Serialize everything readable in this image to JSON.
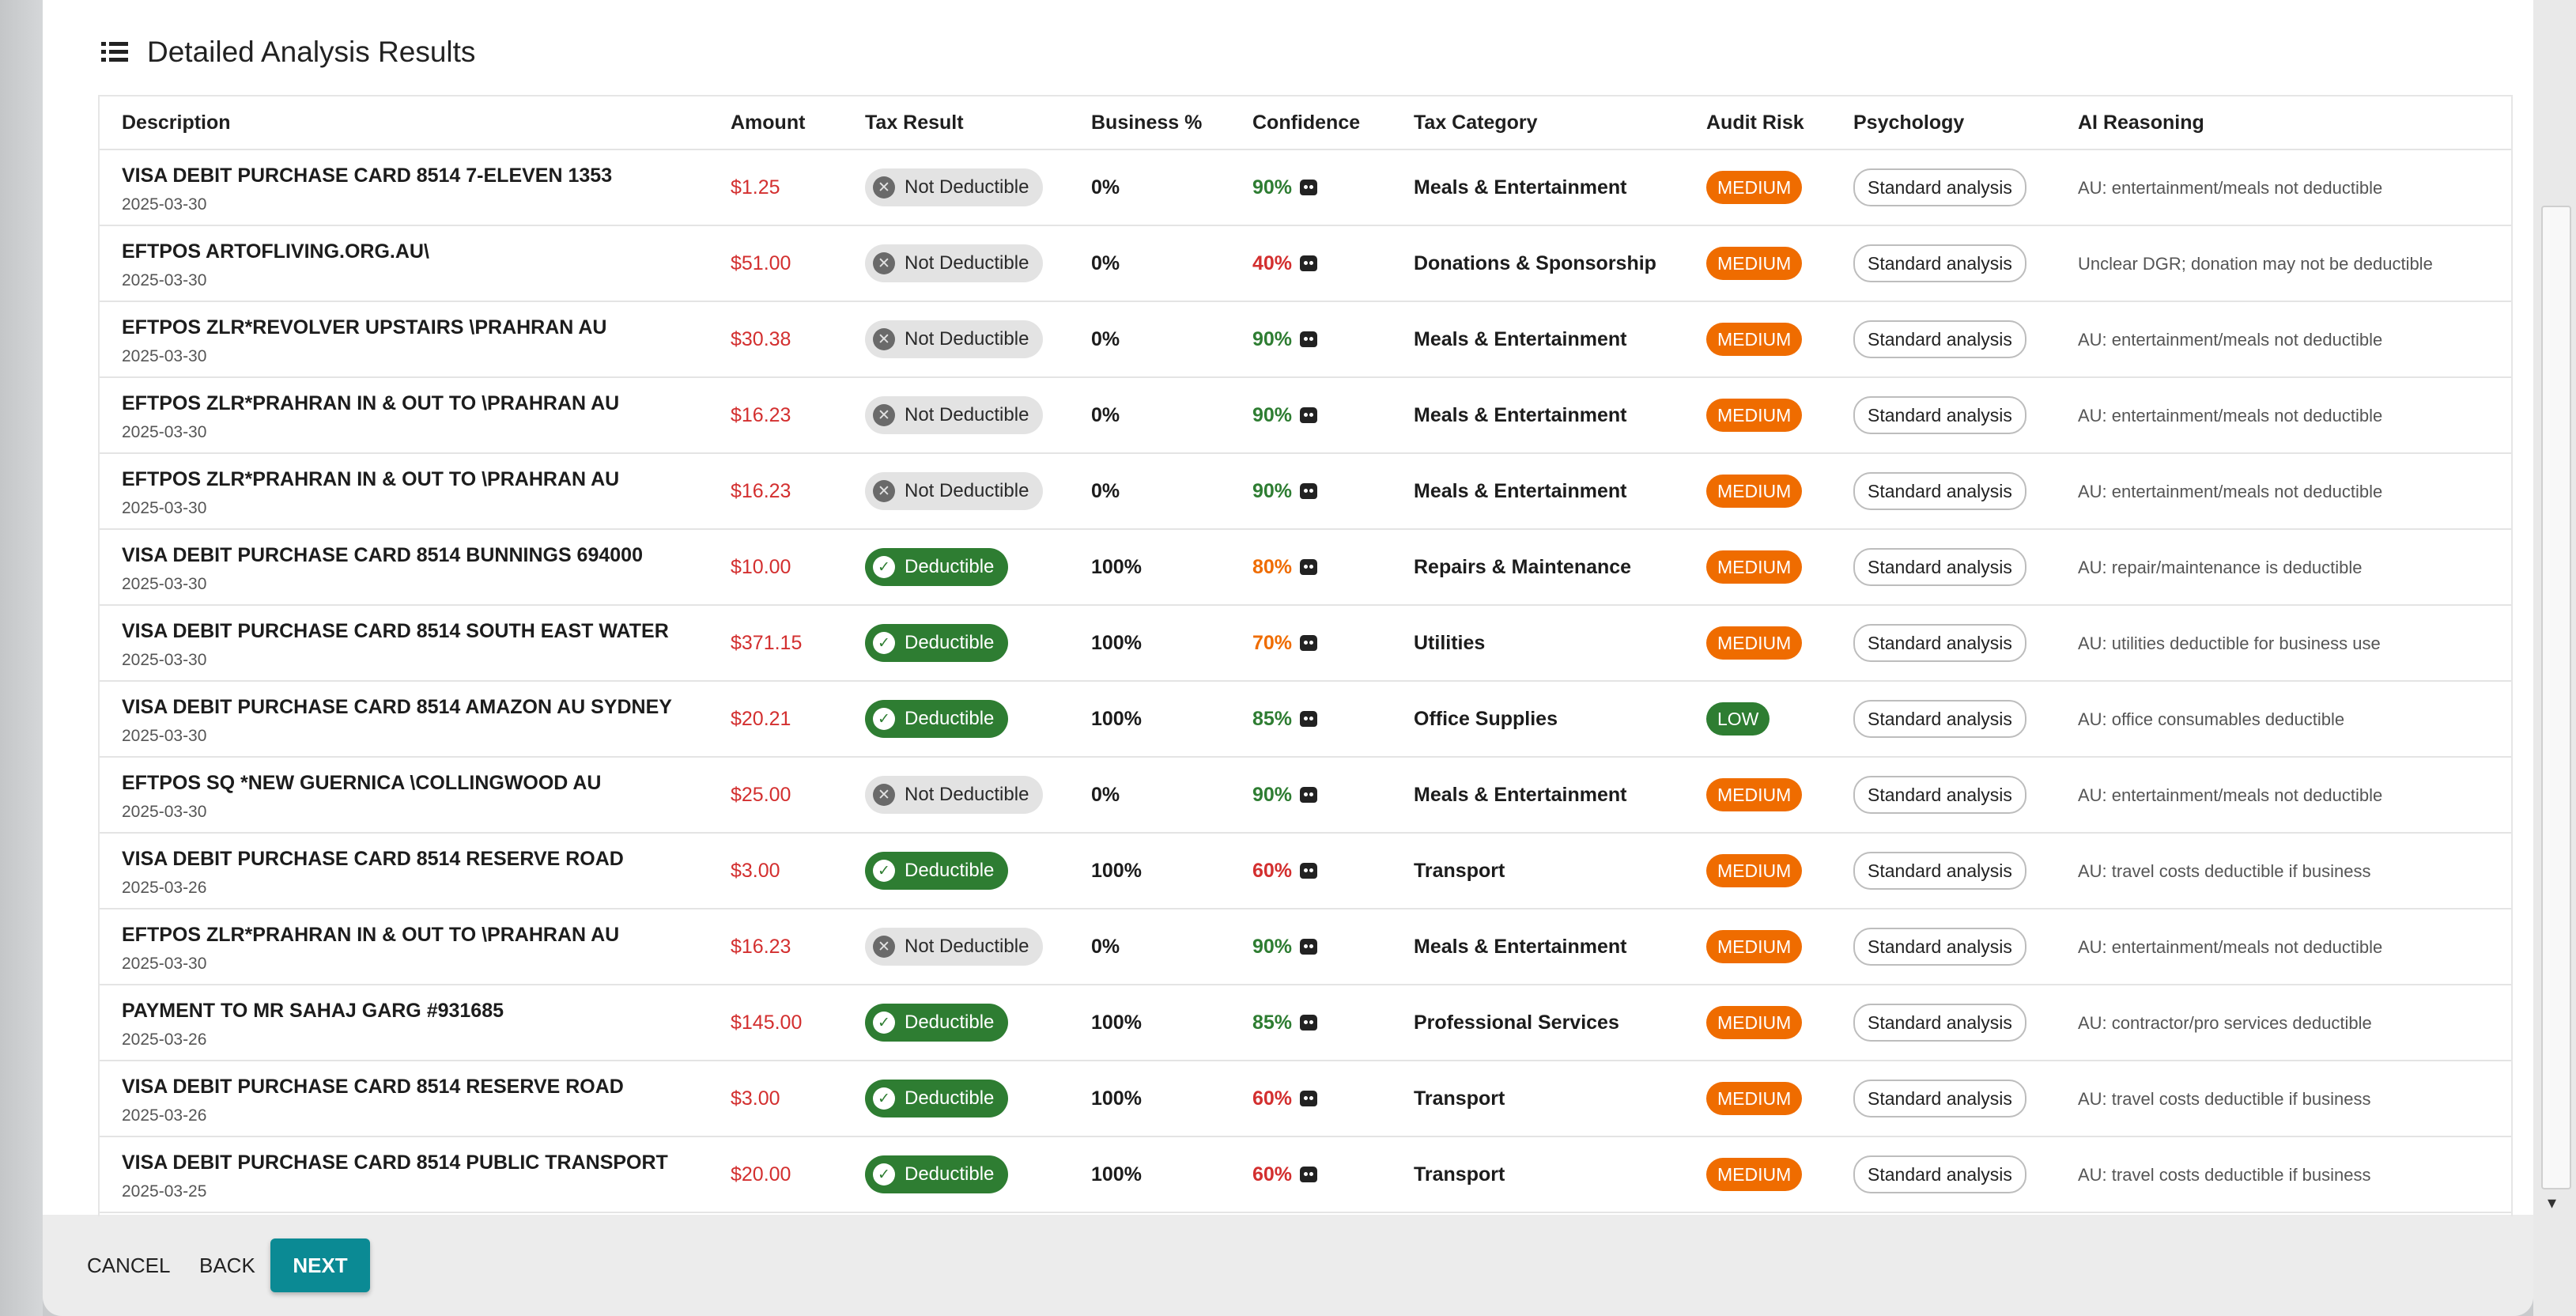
{
  "header": {
    "title": "Detailed Analysis Results",
    "icon": "list-icon"
  },
  "table": {
    "columns": [
      "Description",
      "Amount",
      "Tax Result",
      "Business %",
      "Confidence",
      "Tax Category",
      "Audit Risk",
      "Psychology",
      "AI Reasoning"
    ],
    "rows": [
      {
        "description": "VISA DEBIT PURCHASE CARD 8514 7-ELEVEN 1353",
        "date": "2025-03-30",
        "amount": "$1.25",
        "tax_result": "Not Deductible",
        "deductible": false,
        "business": "0%",
        "confidence": "90%",
        "conf_level": "high",
        "category": "Meals & Entertainment",
        "risk": "MEDIUM",
        "psychology": "Standard analysis",
        "reasoning": "AU: entertainment/meals not deductible"
      },
      {
        "description": "EFTPOS ARTOFLIVING.ORG.AU\\",
        "date": "2025-03-30",
        "amount": "$51.00",
        "tax_result": "Not Deductible",
        "deductible": false,
        "business": "0%",
        "confidence": "40%",
        "conf_level": "low",
        "category": "Donations & Sponsorship",
        "risk": "MEDIUM",
        "psychology": "Standard analysis",
        "reasoning": "Unclear DGR; donation may not be deductible"
      },
      {
        "description": "EFTPOS ZLR*REVOLVER UPSTAIRS \\PRAHRAN AU",
        "date": "2025-03-30",
        "amount": "$30.38",
        "tax_result": "Not Deductible",
        "deductible": false,
        "business": "0%",
        "confidence": "90%",
        "conf_level": "high",
        "category": "Meals & Entertainment",
        "risk": "MEDIUM",
        "psychology": "Standard analysis",
        "reasoning": "AU: entertainment/meals not deductible"
      },
      {
        "description": "EFTPOS ZLR*PRAHRAN IN & OUT TO \\PRAHRAN AU",
        "date": "2025-03-30",
        "amount": "$16.23",
        "tax_result": "Not Deductible",
        "deductible": false,
        "business": "0%",
        "confidence": "90%",
        "conf_level": "high",
        "category": "Meals & Entertainment",
        "risk": "MEDIUM",
        "psychology": "Standard analysis",
        "reasoning": "AU: entertainment/meals not deductible"
      },
      {
        "description": "EFTPOS ZLR*PRAHRAN IN & OUT TO \\PRAHRAN AU",
        "date": "2025-03-30",
        "amount": "$16.23",
        "tax_result": "Not Deductible",
        "deductible": false,
        "business": "0%",
        "confidence": "90%",
        "conf_level": "high",
        "category": "Meals & Entertainment",
        "risk": "MEDIUM",
        "psychology": "Standard analysis",
        "reasoning": "AU: entertainment/meals not deductible"
      },
      {
        "description": "VISA DEBIT PURCHASE CARD 8514 BUNNINGS 694000",
        "date": "2025-03-30",
        "amount": "$10.00",
        "tax_result": "Deductible",
        "deductible": true,
        "business": "100%",
        "confidence": "80%",
        "conf_level": "mid",
        "category": "Repairs & Maintenance",
        "risk": "MEDIUM",
        "psychology": "Standard analysis",
        "reasoning": "AU: repair/maintenance is deductible"
      },
      {
        "description": "VISA DEBIT PURCHASE CARD 8514 SOUTH EAST WATER",
        "date": "2025-03-30",
        "amount": "$371.15",
        "tax_result": "Deductible",
        "deductible": true,
        "business": "100%",
        "confidence": "70%",
        "conf_level": "mid",
        "category": "Utilities",
        "risk": "MEDIUM",
        "psychology": "Standard analysis",
        "reasoning": "AU: utilities deductible for business use"
      },
      {
        "description": "VISA DEBIT PURCHASE CARD 8514 AMAZON AU SYDNEY",
        "date": "2025-03-30",
        "amount": "$20.21",
        "tax_result": "Deductible",
        "deductible": true,
        "business": "100%",
        "confidence": "85%",
        "conf_level": "high",
        "category": "Office Supplies",
        "risk": "LOW",
        "psychology": "Standard analysis",
        "reasoning": "AU: office consumables deductible"
      },
      {
        "description": "EFTPOS SQ *NEW GUERNICA \\COLLINGWOOD AU",
        "date": "2025-03-30",
        "amount": "$25.00",
        "tax_result": "Not Deductible",
        "deductible": false,
        "business": "0%",
        "confidence": "90%",
        "conf_level": "high",
        "category": "Meals & Entertainment",
        "risk": "MEDIUM",
        "psychology": "Standard analysis",
        "reasoning": "AU: entertainment/meals not deductible"
      },
      {
        "description": "VISA DEBIT PURCHASE CARD 8514 RESERVE ROAD",
        "date": "2025-03-26",
        "amount": "$3.00",
        "tax_result": "Deductible",
        "deductible": true,
        "business": "100%",
        "confidence": "60%",
        "conf_level": "low",
        "category": "Transport",
        "risk": "MEDIUM",
        "psychology": "Standard analysis",
        "reasoning": "AU: travel costs deductible if business"
      },
      {
        "description": "EFTPOS ZLR*PRAHRAN IN & OUT TO \\PRAHRAN AU",
        "date": "2025-03-30",
        "amount": "$16.23",
        "tax_result": "Not Deductible",
        "deductible": false,
        "business": "0%",
        "confidence": "90%",
        "conf_level": "high",
        "category": "Meals & Entertainment",
        "risk": "MEDIUM",
        "psychology": "Standard analysis",
        "reasoning": "AU: entertainment/meals not deductible"
      },
      {
        "description": "PAYMENT TO MR SAHAJ GARG #931685",
        "date": "2025-03-26",
        "amount": "$145.00",
        "tax_result": "Deductible",
        "deductible": true,
        "business": "100%",
        "confidence": "85%",
        "conf_level": "high",
        "category": "Professional Services",
        "risk": "MEDIUM",
        "psychology": "Standard analysis",
        "reasoning": "AU: contractor/pro services deductible"
      },
      {
        "description": "VISA DEBIT PURCHASE CARD 8514 RESERVE ROAD",
        "date": "2025-03-26",
        "amount": "$3.00",
        "tax_result": "Deductible",
        "deductible": true,
        "business": "100%",
        "confidence": "60%",
        "conf_level": "low",
        "category": "Transport",
        "risk": "MEDIUM",
        "psychology": "Standard analysis",
        "reasoning": "AU: travel costs deductible if business"
      },
      {
        "description": "VISA DEBIT PURCHASE CARD 8514 PUBLIC TRANSPORT",
        "date": "2025-03-25",
        "amount": "$20.00",
        "tax_result": "Deductible",
        "deductible": true,
        "business": "100%",
        "confidence": "60%",
        "conf_level": "low",
        "category": "Transport",
        "risk": "MEDIUM",
        "psychology": "Standard analysis",
        "reasoning": "AU: travel costs deductible if business"
      }
    ]
  },
  "footer": {
    "cancel": "CANCEL",
    "back": "BACK",
    "next": "NEXT"
  },
  "colors": {
    "amount": "#d32f2f",
    "conf_high": "#2e7d32",
    "conf_mid": "#ef6c00",
    "conf_low": "#d32f2f",
    "risk_medium": "#ef6c00",
    "risk_low": "#2e7d32",
    "deductible": "#2e7d32",
    "not_deductible_bg": "#e3e3e3",
    "primary": "#0b8a94"
  },
  "icons": {
    "deductible": "check-circle-icon",
    "not_deductible": "x-circle-icon",
    "confidence": "robot-icon"
  }
}
